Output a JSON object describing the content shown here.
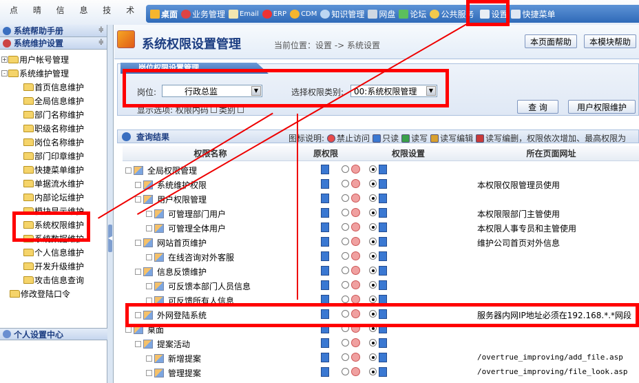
{
  "brand": {
    "text": "点 晴 信 息 技 术"
  },
  "nav": {
    "items": [
      {
        "label": "桌面",
        "icon": "desktop-icon"
      },
      {
        "label": "业务管理",
        "icon": "business-icon"
      },
      {
        "label": "Email",
        "icon": "email-icon"
      },
      {
        "label": "ERP",
        "icon": "erp-icon"
      },
      {
        "label": "CDM",
        "icon": "cdm-icon"
      },
      {
        "label": "知识管理",
        "icon": "knowledge-icon"
      },
      {
        "label": "网盘",
        "icon": "disk-icon"
      },
      {
        "label": "论坛",
        "icon": "forum-icon"
      },
      {
        "label": "公共服务",
        "icon": "public-service-icon"
      },
      {
        "label": "设置",
        "icon": "settings-icon"
      },
      {
        "label": "快捷菜单",
        "icon": "shortcut-icon"
      }
    ]
  },
  "sidebar": {
    "help_title": "系统帮助手册",
    "maint_title": "系统维护设置",
    "personal_title": "个人设置中心",
    "items": [
      {
        "label": "用户帐号管理"
      },
      {
        "label": "系统维护管理"
      },
      {
        "label": "首页信息维护"
      },
      {
        "label": "全局信息维护"
      },
      {
        "label": "部门名称维护"
      },
      {
        "label": "职级名称维护"
      },
      {
        "label": "岗位名称维护"
      },
      {
        "label": "部门印章维护"
      },
      {
        "label": "快捷菜单维护"
      },
      {
        "label": "单据流水维护"
      },
      {
        "label": "内部论坛维护"
      },
      {
        "label": "模块显示维护"
      },
      {
        "label": "系统权限维护"
      },
      {
        "label": "系统数据维护"
      },
      {
        "label": "个人信息维护"
      },
      {
        "label": "开发升级维护"
      },
      {
        "label": "攻击信息查询"
      },
      {
        "label": "修改登陆口令"
      }
    ]
  },
  "header": {
    "title": "系统权限设置管理",
    "breadcrumb": "当前位置：设置 -> 系统设置",
    "help_page": "本页面帮助",
    "help_module": "本模块帮助"
  },
  "filter": {
    "panel_title": "岗位权限设置管理",
    "post_label": "岗位:",
    "post_value": "行政总监",
    "type_label": "选择权限类别:",
    "type_value": "00:系统权限管理",
    "display_label": "显示选项: 权限内码",
    "category_label": "类别",
    "query_btn": "查 询",
    "user_perm_btn": "用户权限维护"
  },
  "results": {
    "title": "查询结果",
    "legend_label": "图标说明:",
    "legend": [
      {
        "label": "禁止访问",
        "color": "#e84a4a"
      },
      {
        "label": "只读",
        "color": "#3a78d2"
      },
      {
        "label": "读写",
        "color": "#3aa04a"
      },
      {
        "label": "读写编辑",
        "color": "#d8a030"
      },
      {
        "label": "读写编删，权限依次增加、最高权限为",
        "color": "#c83a3a"
      }
    ],
    "columns": [
      "权限名称",
      "原权限",
      "权限设置",
      "所在页面网址"
    ],
    "rows": [
      {
        "name": "全局权限管理",
        "note": ""
      },
      {
        "name": "系统维护权限",
        "note": "本权限仅限管理员使用"
      },
      {
        "name": "用户权限管理",
        "note": ""
      },
      {
        "name": "可管理部门用户",
        "note": "本权限限部门主管使用"
      },
      {
        "name": "可管理全体用户",
        "note": "本权限人事专员和主管使用"
      },
      {
        "name": "网站首页维护",
        "note": "维护公司首页对外信息"
      },
      {
        "name": "在线咨询对外客服",
        "note": ""
      },
      {
        "name": "信息反馈维护",
        "note": ""
      },
      {
        "name": "可反馈本部门人员信息",
        "note": ""
      },
      {
        "name": "可反馈所有人信息",
        "note": ""
      },
      {
        "name": "外网登陆系统",
        "note": "服务器内网IP地址必须在192.168.*.*网段"
      },
      {
        "name": "桌面",
        "note": ""
      },
      {
        "name": "提案活动",
        "note": ""
      },
      {
        "name": "新增提案",
        "note": "/overtrue_improving/add_file.asp"
      },
      {
        "name": "管理提案",
        "note": "/overtrue_improving/file_look.asp"
      }
    ]
  }
}
